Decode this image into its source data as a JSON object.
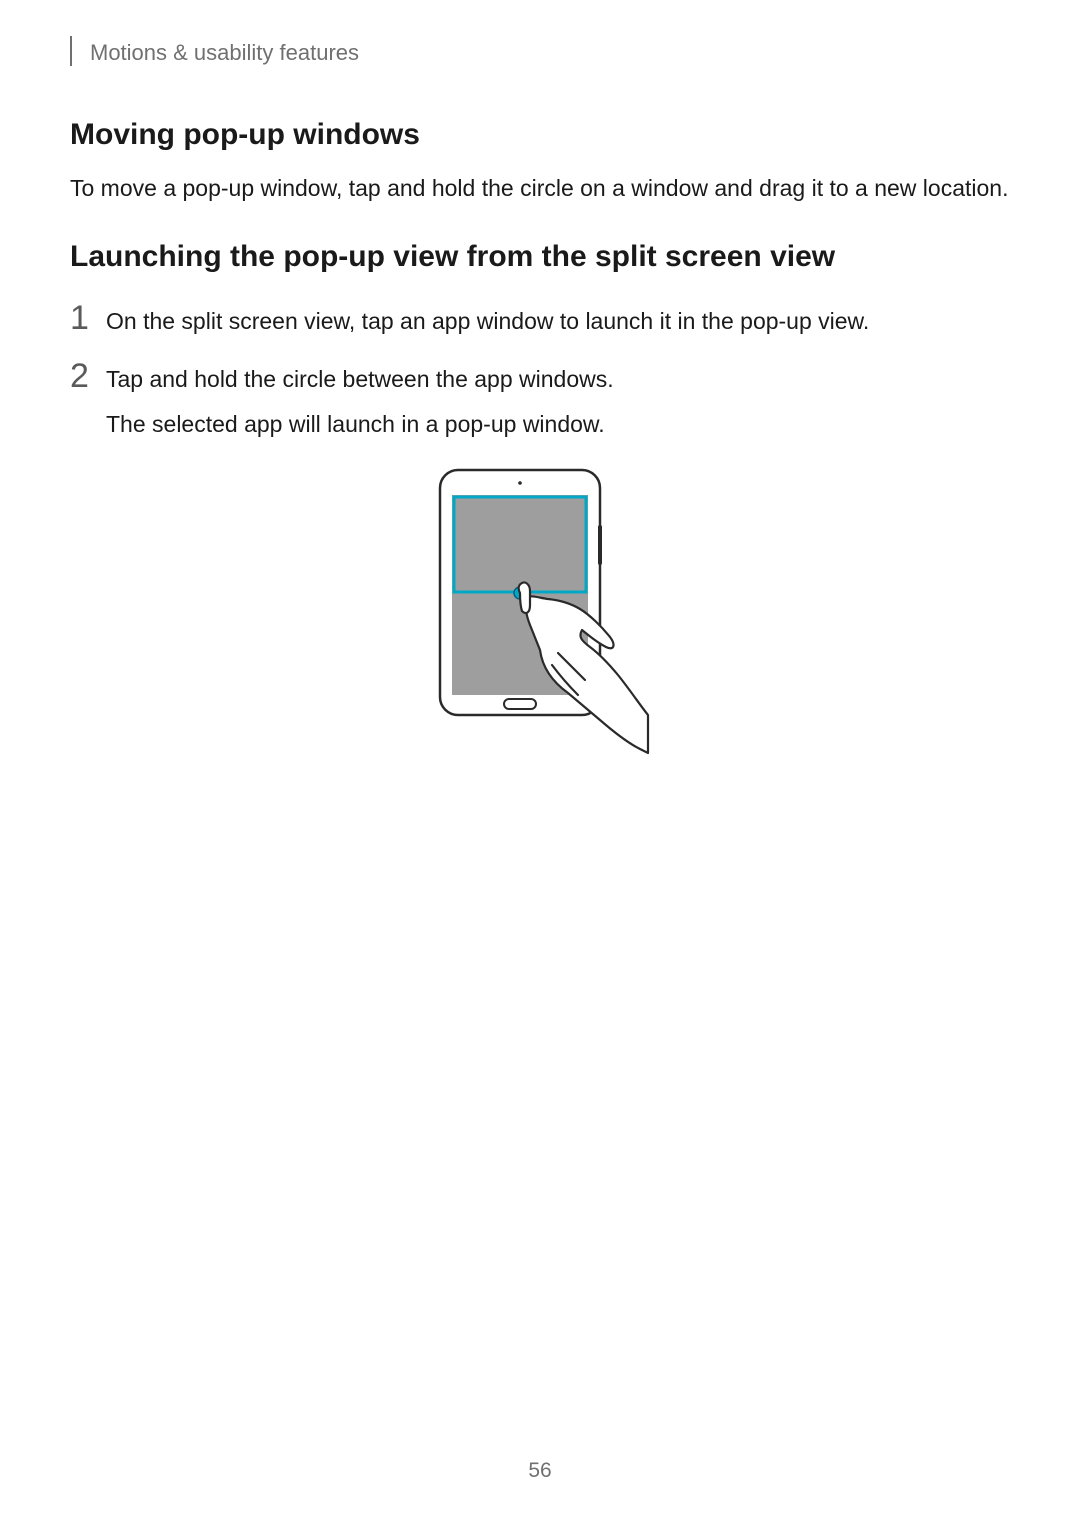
{
  "header": {
    "breadcrumb": "Motions & usability features"
  },
  "sections": {
    "moving_popup": {
      "heading": "Moving pop-up windows",
      "body": "To move a pop-up window, tap and hold the circle on a window and drag it to a new location."
    },
    "launching_popup": {
      "heading": "Launching the pop-up view from the split screen view",
      "steps": [
        {
          "number": "1",
          "text": "On the split screen view, tap an app window to launch it in the pop-up view."
        },
        {
          "number": "2",
          "text_line1": "Tap and hold the circle between the app windows.",
          "text_line2": "The selected app will launch in a pop-up window."
        }
      ]
    }
  },
  "page_number": "56"
}
